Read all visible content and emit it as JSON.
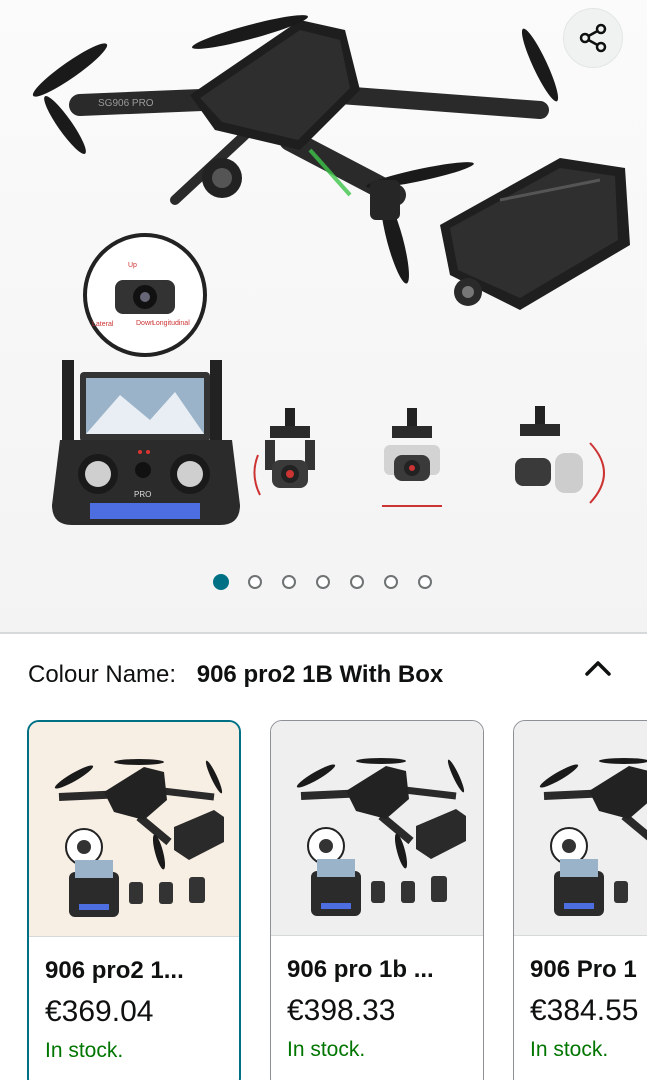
{
  "gallery": {
    "image_alt": "drone",
    "share_icon": "share-icon",
    "dot_count": 7,
    "active_dot": 0,
    "drone_text": "SG906 PRO",
    "controller_text": "PRO",
    "callout_labels": [
      "Lateral",
      "Up",
      "Down",
      "Longitudinal"
    ]
  },
  "colour": {
    "label": "Colour Name:",
    "value": "906 pro2 1B With Box",
    "chevron_icon": "chevron-up-icon"
  },
  "variants": [
    {
      "name": "906 pro2 1...",
      "price": "€369.04",
      "stock": "In stock.",
      "selected": true
    },
    {
      "name": "906 pro 1b ...",
      "price": "€398.33",
      "stock": "In stock.",
      "selected": false
    },
    {
      "name": "906 Pro 1",
      "price": "€384.55",
      "stock": "In stock.",
      "selected": false
    }
  ],
  "colors": {
    "accent": "#007185",
    "stock": "#007600"
  }
}
